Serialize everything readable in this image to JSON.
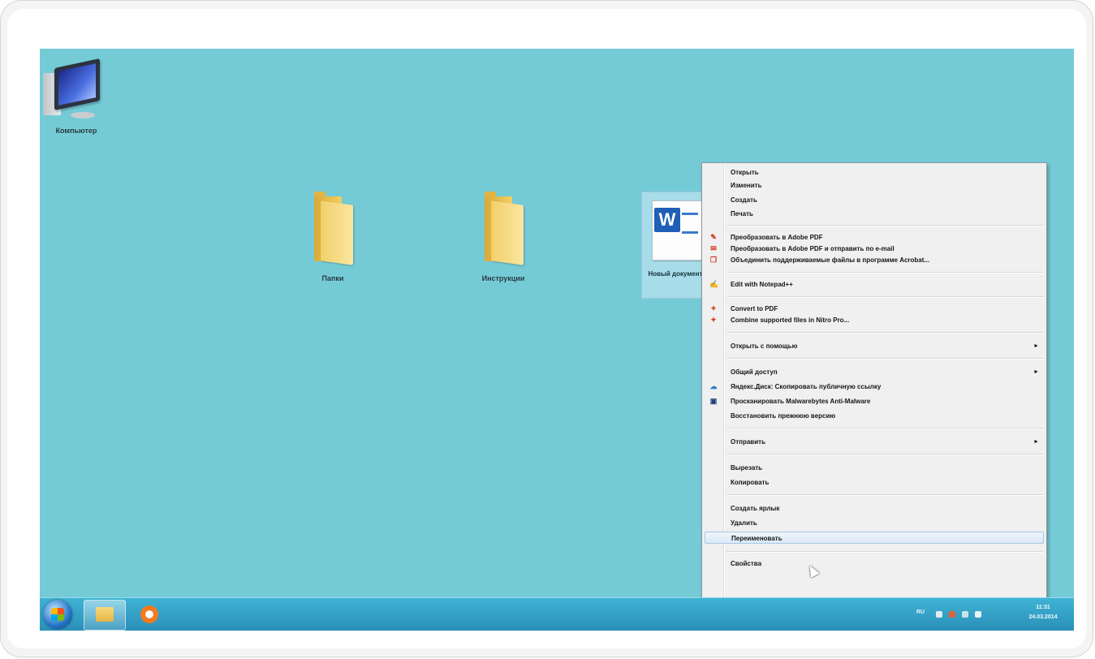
{
  "desktop": {
    "icons": {
      "computer": {
        "label": "Компьютер"
      },
      "folder1": {
        "label": "Папки"
      },
      "folder2": {
        "label": "Инструкции"
      },
      "word_doc": {
        "label": "Новый документ"
      }
    }
  },
  "context_menu": {
    "items": [
      {
        "label": "Открыть"
      },
      {
        "label": "Изменить"
      },
      {
        "label": "Создать"
      },
      {
        "label": "Печать"
      },
      {
        "label": "Преобразовать в Adobe PDF",
        "icon": "acrobat-icon"
      },
      {
        "label": "Преобразовать в Adobe PDF и отправить по e-mail",
        "icon": "acrobat-mail-icon"
      },
      {
        "label": "Объединить поддерживаемые файлы в программе Acrobat...",
        "icon": "acrobat-combine-icon"
      },
      {
        "label": "Edit with Notepad++",
        "icon": "notepad-plus-icon"
      },
      {
        "label": "Convert to PDF",
        "icon": "nitro-icon"
      },
      {
        "label": "Combine supported files in Nitro Pro...",
        "icon": "nitro-combine-icon"
      },
      {
        "label": "Открыть с помощью"
      },
      {
        "label": "Общий доступ"
      },
      {
        "label": "Яндекс.Диск: Скопировать публичную ссылку",
        "icon": "yandex-disk-icon"
      },
      {
        "label": "Просканировать Malwarebytes Anti-Malware",
        "icon": "malwarebytes-icon"
      },
      {
        "label": "Восстановить прежнюю версию"
      },
      {
        "label": "Отправить"
      },
      {
        "label": "Вырезать"
      },
      {
        "label": "Копировать"
      },
      {
        "label": "Создать ярлык"
      },
      {
        "label": "Удалить"
      },
      {
        "label": "Переименовать"
      },
      {
        "label": "Свойства"
      }
    ],
    "submenu_arrow": "►"
  },
  "taskbar": {
    "tray": {
      "lang": "RU",
      "time": "11:31",
      "date": "24.03.2014"
    }
  },
  "colors": {
    "desktop": "#74cbd6",
    "taskbar": "#2b8fb8",
    "menu_bg": "#f0f0f0",
    "highlight": "#dbe9f6"
  }
}
